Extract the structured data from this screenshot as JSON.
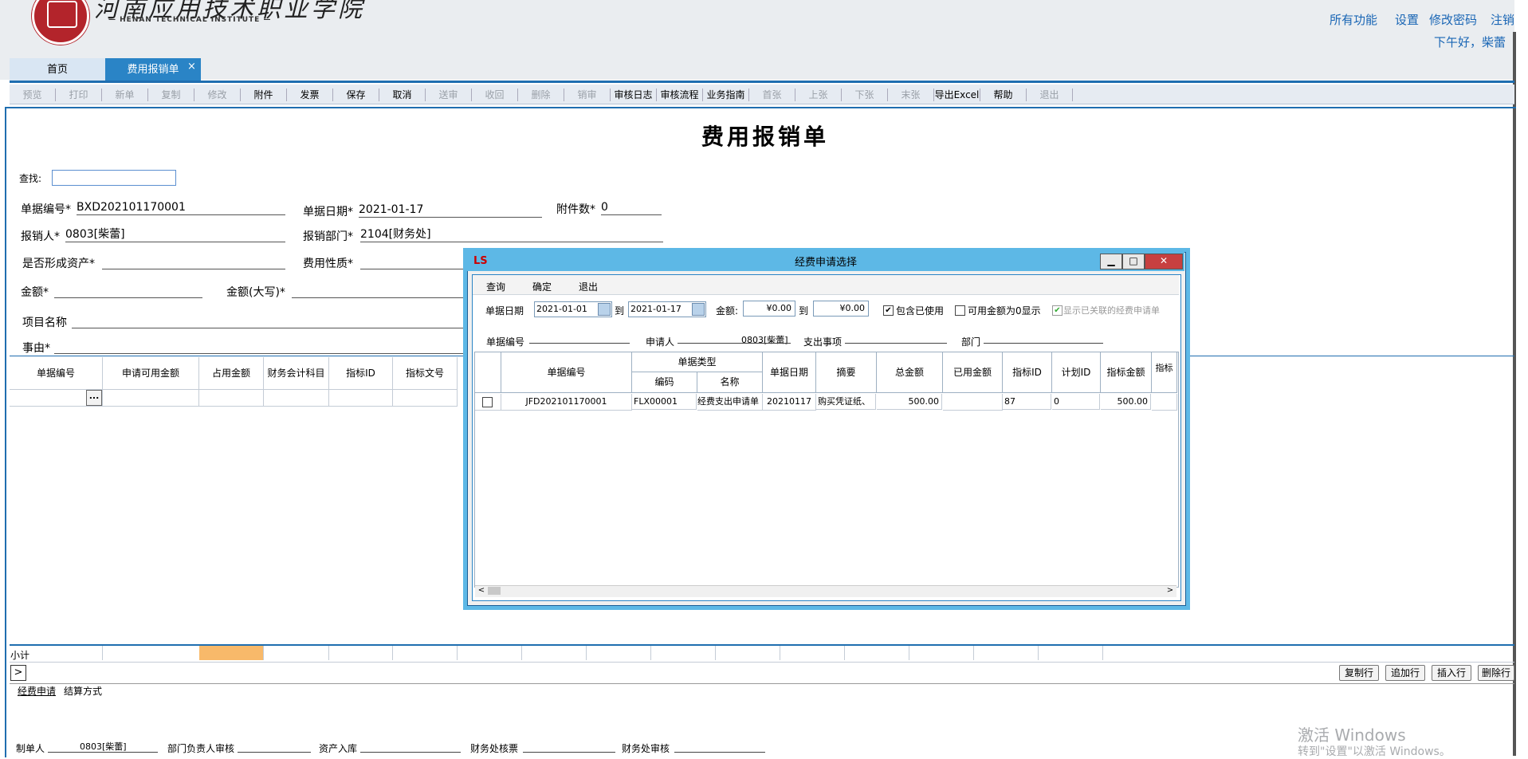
{
  "header": {
    "school_name_cn": "河南应用技术职业学院",
    "school_name_en": "— HENAN TECHNICAL INSTITUTE —",
    "links": [
      "所有功能",
      "设置",
      "修改密码",
      "注销"
    ],
    "greeting": "下午好，柴蕾"
  },
  "tabs": [
    {
      "label": "首页",
      "active": false
    },
    {
      "label": "费用报销单",
      "active": true
    }
  ],
  "toolbar": {
    "buttons": [
      {
        "label": "预览",
        "enabled": false
      },
      {
        "label": "打印",
        "enabled": false
      },
      {
        "label": "新单",
        "enabled": false
      },
      {
        "label": "复制",
        "enabled": false
      },
      {
        "label": "修改",
        "enabled": false
      },
      {
        "label": "附件",
        "enabled": true
      },
      {
        "label": "发票",
        "enabled": true
      },
      {
        "label": "保存",
        "enabled": true
      },
      {
        "label": "取消",
        "enabled": true
      },
      {
        "label": "送审",
        "enabled": false
      },
      {
        "label": "收回",
        "enabled": false
      },
      {
        "label": "删除",
        "enabled": false
      },
      {
        "label": "销审",
        "enabled": false
      },
      {
        "label": "审核日志",
        "enabled": true
      },
      {
        "label": "审核流程",
        "enabled": true
      },
      {
        "label": "业务指南",
        "enabled": true
      },
      {
        "label": "首张",
        "enabled": false
      },
      {
        "label": "上张",
        "enabled": false
      },
      {
        "label": "下张",
        "enabled": false
      },
      {
        "label": "末张",
        "enabled": false
      },
      {
        "label": "导出Excel",
        "enabled": true
      },
      {
        "label": "帮助",
        "enabled": true
      },
      {
        "label": "退出",
        "enabled": false
      }
    ]
  },
  "form": {
    "title": "费用报销单",
    "search_label": "查找:",
    "doc_no_label": "单据编号*",
    "doc_no": "BXD202101170001",
    "doc_date_label": "单据日期*",
    "doc_date": "2021-01-17",
    "attach_label": "附件数*",
    "attach": "0",
    "person_label": "报销人*",
    "person": "0803[柴蕾]",
    "dept_label": "报销部门*",
    "dept": "2104[财务处]",
    "asset_label": "是否形成资产*",
    "nature_label": "费用性质*",
    "amount_label": "金额*",
    "amount_cap_label": "金额(大写)*",
    "project_label": "项目名称",
    "reason_label": "事由*"
  },
  "grid": {
    "columns": [
      "单据编号",
      "申请可用金额",
      "占用金额",
      "财务会计科目",
      "指标ID",
      "指标文号"
    ],
    "ellipsis": "...",
    "subtotal_label": "小计",
    "row_buttons": [
      "复制行",
      "追加行",
      "插入行",
      "删除行"
    ],
    "subtabs": [
      "经费申请",
      "结算方式"
    ]
  },
  "signatures": {
    "maker_label": "制单人",
    "maker": "0803[柴蕾]",
    "dept_head_label": "部门负责人审核",
    "asset_in_label": "资产入库",
    "finance_ticket_label": "财务处核票",
    "finance_audit_label": "财务处审核"
  },
  "watermark": {
    "line1": "激活 Windows",
    "line2": "转到\"设置\"以激活 Windows。"
  },
  "dialog": {
    "title": "经费申请选择",
    "logo": "LS",
    "window_buttons": {
      "minimize": "▁",
      "maximize": "□",
      "close": "✕"
    },
    "menu": [
      "查询",
      "确定",
      "退出"
    ],
    "date_label": "单据日期",
    "date_from": "2021-01-01",
    "to_label": "到",
    "date_to": "2021-01-17",
    "amount_label": "金额:",
    "amount_from": "¥0.00",
    "amount_to": "¥0.00",
    "include_used": {
      "label": "包含已使用",
      "checked": true
    },
    "show_zero": {
      "label": "可用金额为0显示",
      "checked": false
    },
    "show_linked": {
      "label": "显示已关联的经费申请单",
      "checked": true,
      "enabled": false
    },
    "filter_doc_no_label": "单据编号",
    "filter_applicant_label": "申请人",
    "filter_applicant": "0803[柴蕾]",
    "filter_expense_label": "支出事项",
    "filter_dept_label": "部门",
    "columns": {
      "doc_no": "单据编号",
      "doc_type": "单据类型",
      "code": "编码",
      "name": "名称",
      "doc_date": "单据日期",
      "summary": "摘要",
      "total": "总金额",
      "used": "已用金额",
      "index_id": "指标ID",
      "plan_id": "计划ID",
      "index_amount": "指标金额",
      "index_extra": "指标可"
    },
    "rows": [
      {
        "checked": false,
        "doc_no": "JFD202101170001",
        "code": "FLX00001",
        "name": "经费支出申请单",
        "doc_date": "20210117",
        "summary": "购买凭证纸、",
        "total": "500.00",
        "used": "",
        "index_id": "87",
        "plan_id": "0",
        "index_amount": "500.00"
      }
    ]
  }
}
